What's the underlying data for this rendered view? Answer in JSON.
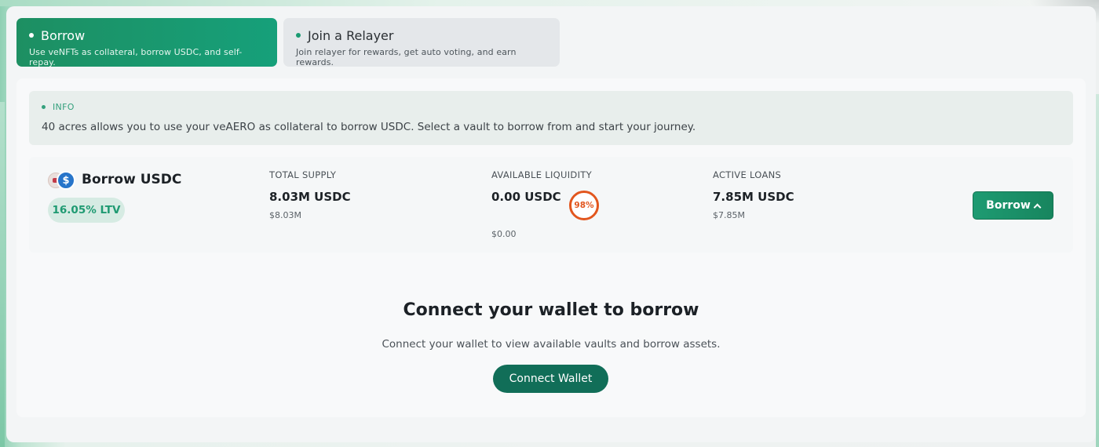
{
  "tabs": [
    {
      "title": "Borrow",
      "subtitle": "Use veNFTs as collateral, borrow USDC, and self-repay."
    },
    {
      "title": "Join a Relayer",
      "subtitle": "Join relayer for rewards, get auto voting, and earn rewards."
    }
  ],
  "info": {
    "label": "INFO",
    "text": "40 acres allows you to use your veAERO as collateral to borrow USDC. Select a vault to borrow from and start your journey."
  },
  "vault": {
    "name": "Borrow USDC",
    "token_symbol": "$",
    "ltv": "16.05% LTV",
    "total_supply": {
      "label": "TOTAL SUPPLY",
      "value": "8.03M USDC",
      "usd": "$8.03M"
    },
    "available_liquidity": {
      "label": "AVAILABLE LIQUIDITY",
      "value": "0.00 USDC",
      "usd": "$0.00",
      "utilization": "98%"
    },
    "active_loans": {
      "label": "ACTIVE LOANS",
      "value": "7.85M USDC",
      "usd": "$7.85M"
    },
    "borrow_button": "Borrow"
  },
  "connect": {
    "title": "Connect your wallet to borrow",
    "subtitle": "Connect your wallet to view available vaults and borrow assets.",
    "button": "Connect Wallet"
  },
  "colors": {
    "accent": "#1d8f62",
    "utilization": "#e2561e",
    "usdc": "#2775ca"
  },
  "icons": [
    "usdc-icon",
    "token-icon",
    "chevron-up-icon"
  ]
}
